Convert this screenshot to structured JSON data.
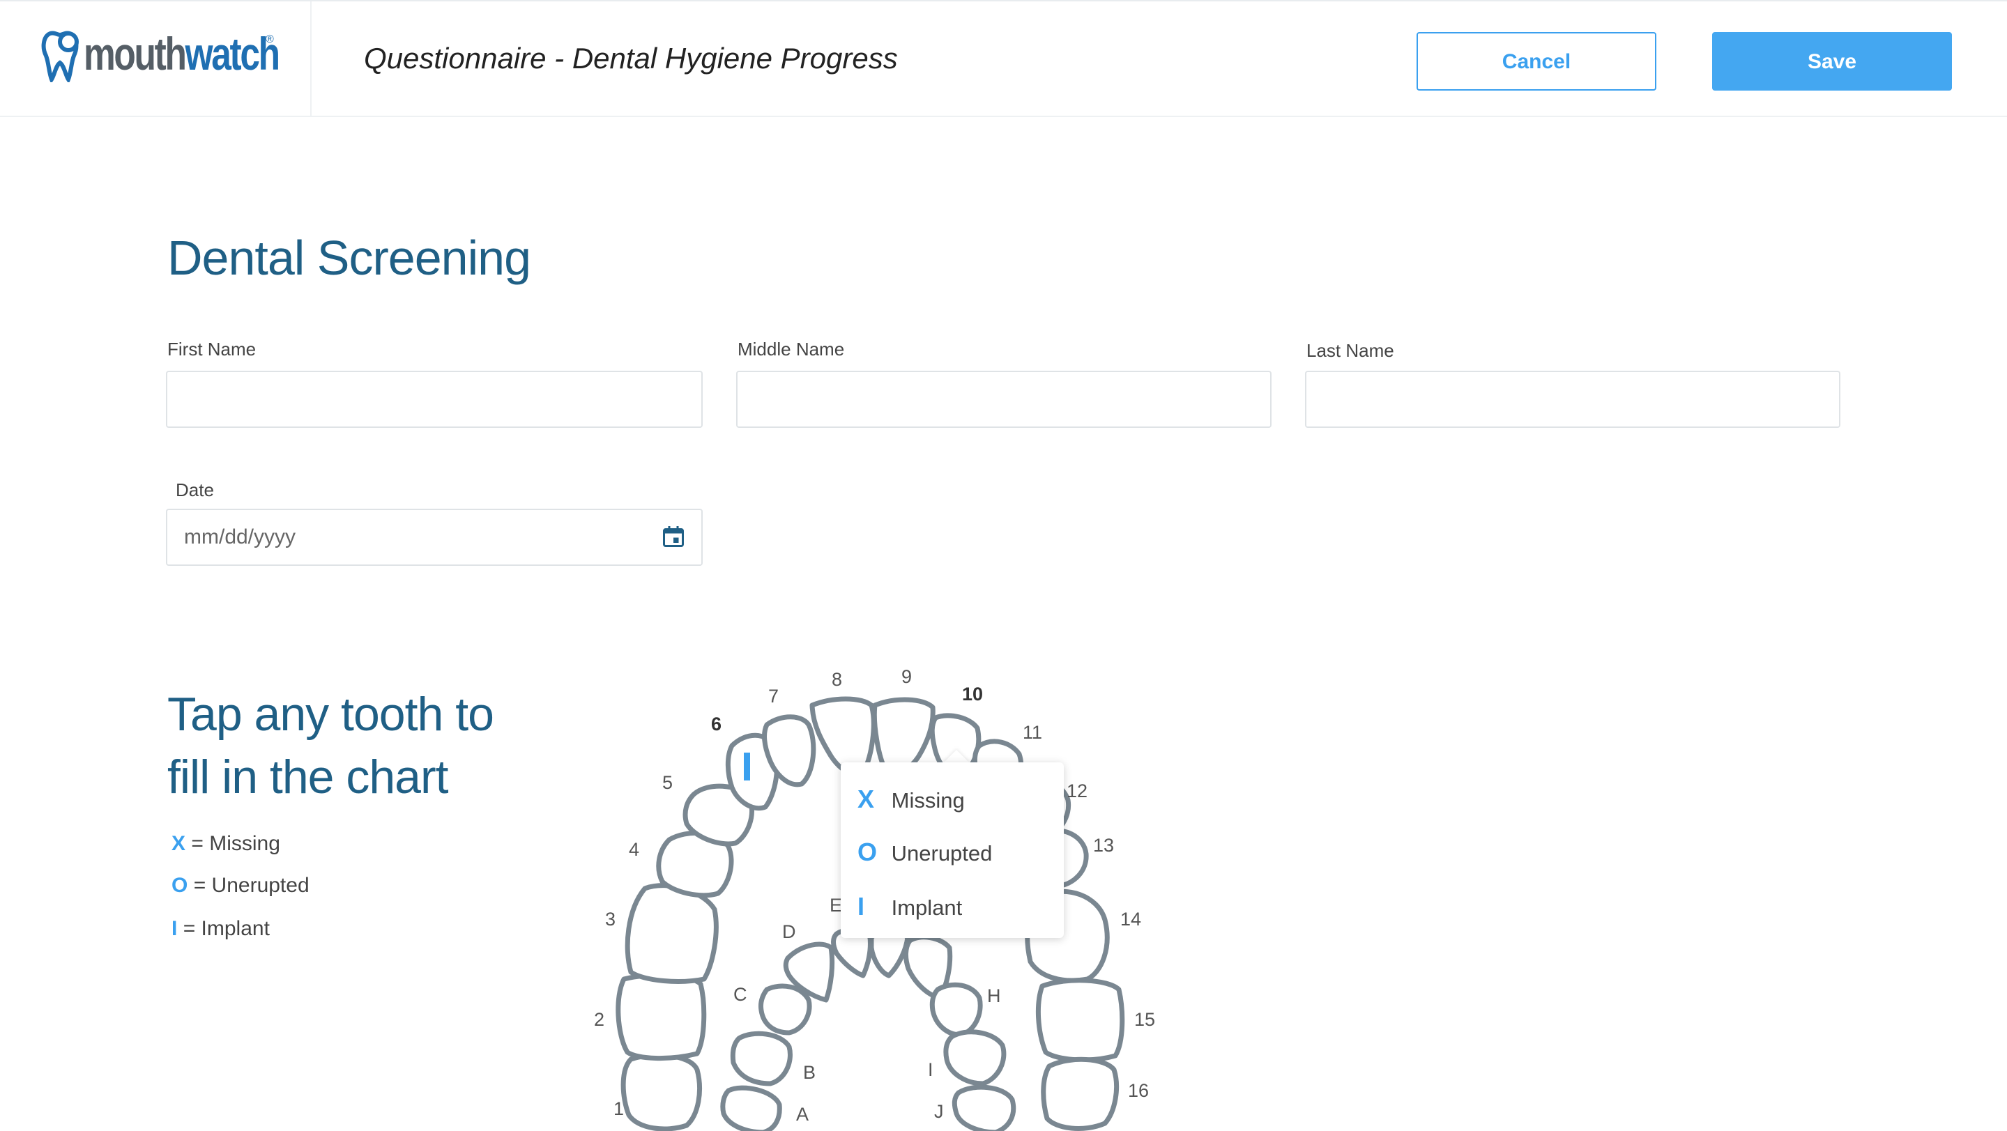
{
  "header": {
    "logo_text_mouth": "mouth",
    "logo_text_watch": "watch",
    "logo_reg": "®",
    "title": "Questionnaire - Dental Hygiene Progress",
    "cancel_label": "Cancel",
    "save_label": "Save"
  },
  "form": {
    "section_title": "Dental Screening",
    "first_name_label": "First Name",
    "first_name_value": "",
    "middle_name_label": "Middle Name",
    "middle_name_value": "",
    "last_name_label": "Last Name",
    "last_name_value": "",
    "date_label": "Date",
    "date_placeholder": "mm/dd/yyyy"
  },
  "chart_section": {
    "heading_line1": "Tap any tooth to",
    "heading_line2": "fill in the  chart",
    "legend": [
      {
        "symbol": "X",
        "label": "= Missing"
      },
      {
        "symbol": "O",
        "label": "= Unerupted"
      },
      {
        "symbol": "I",
        "label": "= Implant"
      }
    ],
    "adult_teeth": [
      "1",
      "2",
      "3",
      "4",
      "5",
      "6",
      "7",
      "8",
      "9",
      "10",
      "11",
      "12",
      "13",
      "14",
      "15",
      "16"
    ],
    "child_teeth": [
      "A",
      "B",
      "C",
      "D",
      "E",
      "H",
      "I",
      "J"
    ],
    "marked_teeth": [
      {
        "tooth": "6",
        "mark": "I"
      }
    ],
    "bold_teeth": [
      "6",
      "10"
    ]
  },
  "popup": {
    "items": [
      {
        "symbol": "X",
        "label": "Missing"
      },
      {
        "symbol": "O",
        "label": "Unerupted"
      },
      {
        "symbol": "I",
        "label": "Implant"
      }
    ]
  },
  "colors": {
    "accent": "#3aa0ef",
    "heading": "#1f5f85",
    "tooth_stroke": "#7a8791"
  }
}
